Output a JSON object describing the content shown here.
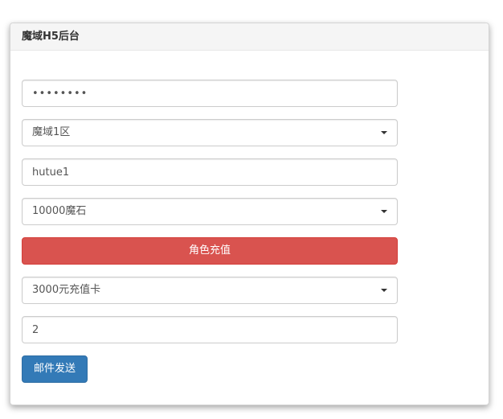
{
  "panel": {
    "title": "魔域H5后台"
  },
  "form": {
    "password_value": "••••••••",
    "server_select": "魔域1区",
    "role_name_value": "hutue1",
    "recharge_amount_select": "10000魔石",
    "recharge_button_label": "角色充值",
    "mail_item_select": "3000元充值卡",
    "mail_quantity_value": "2",
    "send_mail_button_label": "邮件发送"
  },
  "colors": {
    "danger": "#d9534f",
    "primary": "#337ab7"
  }
}
